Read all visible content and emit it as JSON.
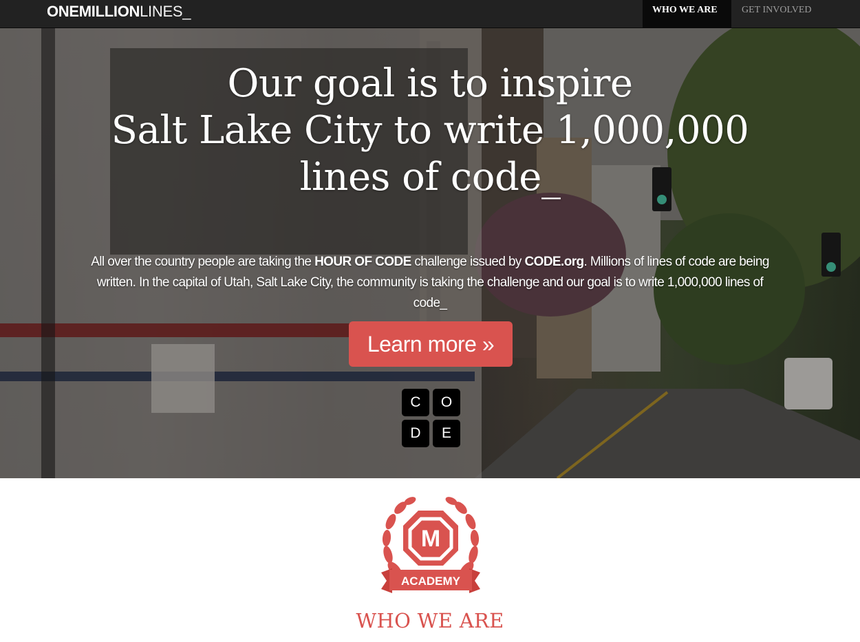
{
  "nav": {
    "brand_bold": "ONEMILLION",
    "brand_light": "LINES_",
    "items": [
      {
        "label": "WHO WE ARE",
        "active": true
      },
      {
        "label": "GET INVOLVED",
        "active": false
      }
    ]
  },
  "hero": {
    "headline": [
      "Our goal is to inspire",
      "Salt Lake City to write 1,000,000",
      "lines of code_"
    ],
    "intro": {
      "part1": "All over the country people are taking the ",
      "hour_of_code": "HOUR OF CODE",
      "part2": " challenge issued by ",
      "code_org": "CODE.org",
      "part3": ". Millions of lines of code are being written. In the capital of Utah, Salt Lake City, the community is taking the challenge and our goal is to write 1,000,000 lines of code_"
    },
    "cta_label": "Learn more »",
    "code_logo_letters": [
      "C",
      "O",
      "D",
      "E"
    ]
  },
  "academy_logo": {
    "letter": "M",
    "banner_text": "ACADEMY"
  },
  "section": {
    "title": "WHO WE ARE"
  },
  "colors": {
    "accent": "#d9534f",
    "navbar": "#222222",
    "nav_active": "#0a0a0a",
    "nav_inactive_text": "#9d9d9d"
  },
  "icons": {
    "academy_logo": "laurel-wreath-badge-icon",
    "code_logo": "code-org-logo-icon"
  }
}
